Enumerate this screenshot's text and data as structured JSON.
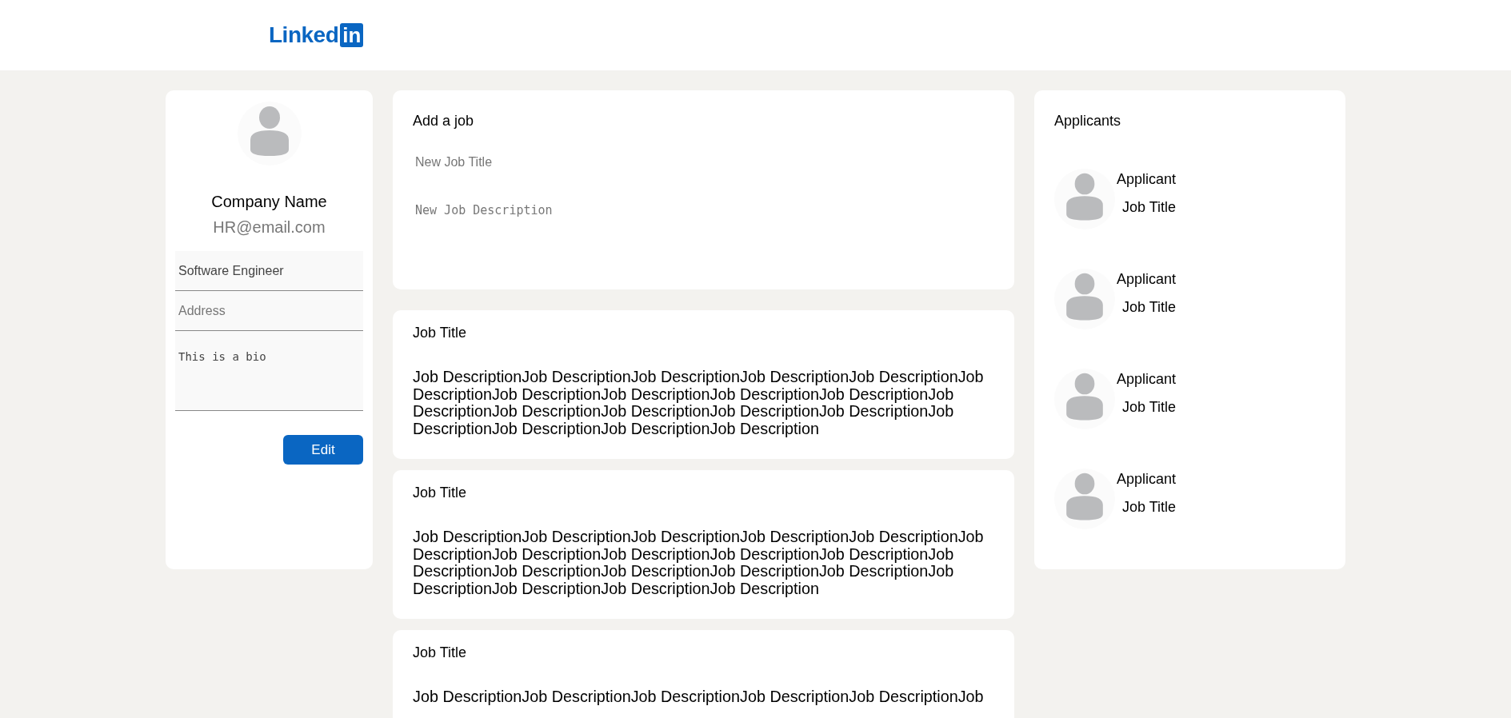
{
  "header": {
    "logo": {
      "word": "Linked",
      "badge": "in"
    }
  },
  "profile": {
    "name": "Company Name",
    "email": "HR@email.com",
    "fields": [
      {
        "kind": "input",
        "value": "Software Engineer"
      },
      {
        "kind": "input",
        "placeholder": "Address"
      },
      {
        "kind": "textarea",
        "value": "This is a bio"
      }
    ],
    "button": "Edit"
  },
  "add_job": {
    "title": "Add a job",
    "title_field": {
      "placeholder": "New Job Title"
    },
    "description_field": {
      "placeholder": "New Job Description"
    }
  },
  "jobs": [
    {
      "title": "Job Title",
      "description": "Job DescriptionJob DescriptionJob DescriptionJob DescriptionJob DescriptionJob DescriptionJob DescriptionJob DescriptionJob DescriptionJob DescriptionJob DescriptionJob DescriptionJob DescriptionJob DescriptionJob DescriptionJob DescriptionJob DescriptionJob DescriptionJob Description"
    },
    {
      "title": "Job Title",
      "description": "Job DescriptionJob DescriptionJob DescriptionJob DescriptionJob DescriptionJob DescriptionJob DescriptionJob DescriptionJob DescriptionJob DescriptionJob DescriptionJob DescriptionJob DescriptionJob DescriptionJob DescriptionJob DescriptionJob DescriptionJob DescriptionJob Description"
    },
    {
      "title": "Job Title",
      "description": "Job DescriptionJob DescriptionJob DescriptionJob DescriptionJob DescriptionJob"
    }
  ],
  "applicants": {
    "title": "Applicants",
    "items": [
      {
        "name": "Applicant",
        "job": "Job Title"
      },
      {
        "name": "Applicant",
        "job": "Job Title"
      },
      {
        "name": "Applicant",
        "job": "Job Title"
      },
      {
        "name": "Applicant",
        "job": "Job Title"
      }
    ]
  }
}
